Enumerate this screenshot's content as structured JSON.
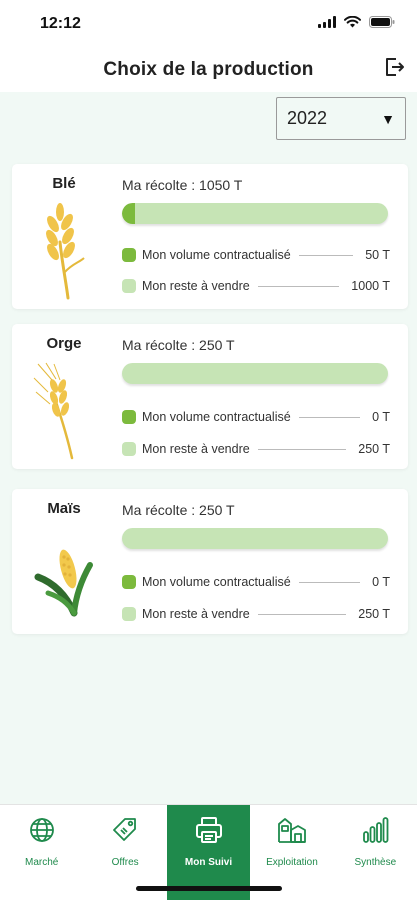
{
  "status_bar": {
    "time": "12:12"
  },
  "header": {
    "title": "Choix de la production"
  },
  "year_select": {
    "value": "2022",
    "caret": "▼"
  },
  "colors": {
    "contracted": "#7cba3d",
    "remaining": "#c6e4b5",
    "brand_green": "#1f8a4c",
    "background": "#f1f9f5"
  },
  "crops": [
    {
      "name": "Blé",
      "icon": "wheat-icon",
      "harvest_label": "Ma récolte : 1050 T",
      "contracted_fraction": 0.048,
      "contracted_label": "Mon volume contractualisé",
      "contracted_value": "50 T",
      "remaining_label": "Mon reste à vendre",
      "remaining_value": "1000 T"
    },
    {
      "name": "Orge",
      "icon": "barley-icon",
      "harvest_label": "Ma récolte : 250 T",
      "contracted_fraction": 0,
      "contracted_label": "Mon volume contractualisé",
      "contracted_value": "0 T",
      "remaining_label": "Mon reste à vendre",
      "remaining_value": "250 T"
    },
    {
      "name": "Maïs",
      "icon": "corn-icon",
      "harvest_label": "Ma récolte : 250 T",
      "contracted_fraction": 0,
      "contracted_label": "Mon volume contractualisé",
      "contracted_value": "0 T",
      "remaining_label": "Mon reste à vendre",
      "remaining_value": "250 T"
    }
  ],
  "bottom_nav": [
    {
      "label": "Marché",
      "icon": "globe-icon",
      "active": false
    },
    {
      "label": "Offres",
      "icon": "tag-icon",
      "active": false
    },
    {
      "label": "Mon Suivi",
      "icon": "printer-icon",
      "active": true
    },
    {
      "label": "Exploitation",
      "icon": "farm-icon",
      "active": false
    },
    {
      "label": "Synthèse",
      "icon": "bar-chart-icon",
      "active": false
    }
  ]
}
